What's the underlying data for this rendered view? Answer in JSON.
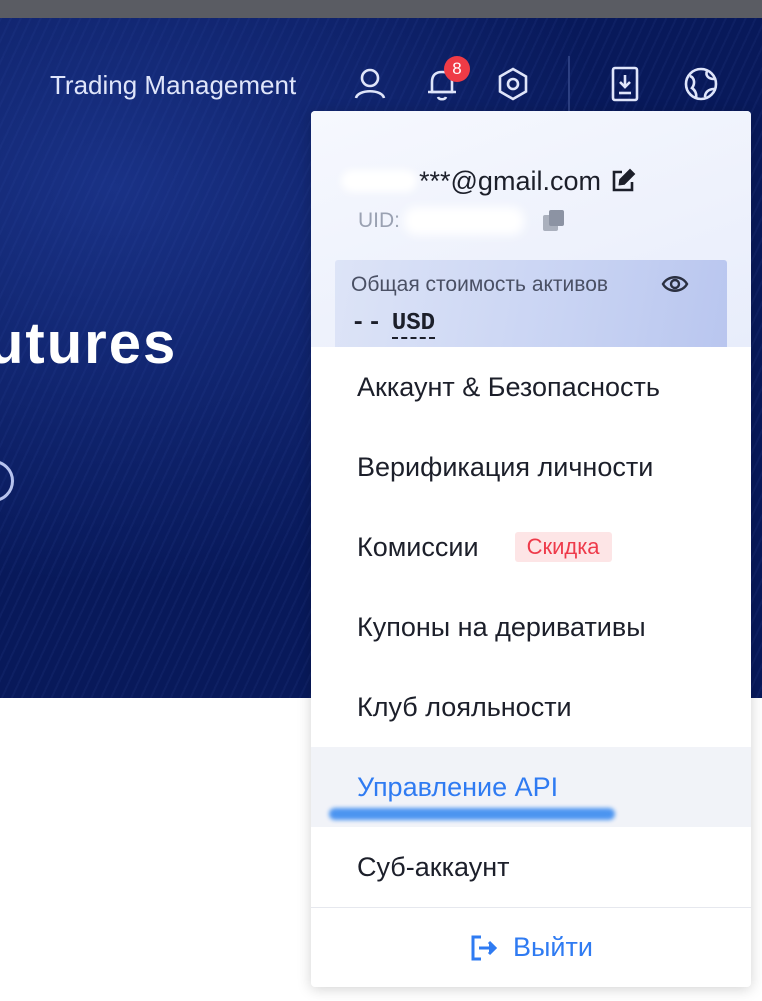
{
  "header": {
    "nav_text": "Trading Management",
    "notification_count": "8",
    "icons": [
      "user-icon",
      "bell-icon",
      "settings-hex-icon",
      "download-icon",
      "globe-icon"
    ]
  },
  "hero": {
    "title_fragment": "utures"
  },
  "account_menu": {
    "email": "***@gmail.com",
    "uid_label": "UID:",
    "total_assets_label": "Общая стоимость активов",
    "total_assets_value": "--",
    "total_assets_currency": "USD",
    "items": [
      {
        "label": "Аккаунт & Безопасность"
      },
      {
        "label": "Верификация личности"
      },
      {
        "label": "Комиссии",
        "badge": "Скидка"
      },
      {
        "label": "Купоны на деривативы"
      },
      {
        "label": "Клуб лояльности"
      },
      {
        "label": "Управление API",
        "active": true
      },
      {
        "label": "Суб-аккаунт"
      }
    ],
    "logout_label": "Выйти"
  },
  "colors": {
    "hero_bg": "#08195a",
    "accent_blue": "#2f7bf2",
    "badge_red": "#ef3b46",
    "discount_text": "#ee3a4a",
    "discount_bg": "#fde5e6"
  }
}
